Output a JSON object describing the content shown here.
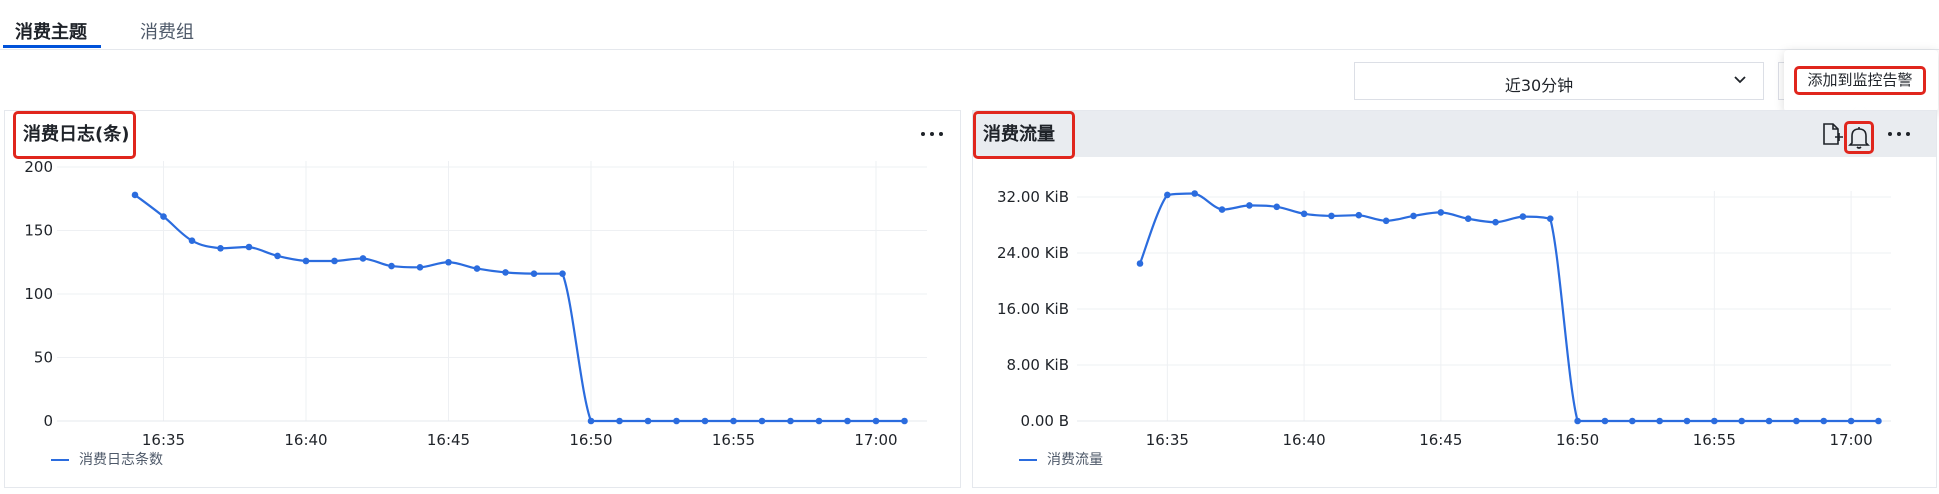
{
  "tabs": [
    {
      "label": "消费主题",
      "active": true
    },
    {
      "label": "消费组",
      "active": false
    }
  ],
  "time_range": {
    "selected": "近30分钟"
  },
  "tooltip": {
    "text": "添加到监控告警"
  },
  "icons": {
    "export": "add-file-icon",
    "alert": "bell-icon",
    "more": "more-dots-icon",
    "dropdown": "chevron-down-icon"
  },
  "colors": {
    "series": "#2b6cde",
    "highlight": "#e0261d",
    "active_tab": "#0052d9"
  },
  "panels": [
    {
      "title": "消费日志(条)",
      "legend": "消费日志条数"
    },
    {
      "title": "消费流量",
      "legend": "消费流量"
    }
  ],
  "chart_data": [
    {
      "type": "line",
      "title": "消费日志(条)",
      "xlabel": "",
      "ylabel": "",
      "x_ticks": [
        "16:35",
        "16:40",
        "16:45",
        "16:50",
        "16:55",
        "17:00"
      ],
      "y_ticks": [
        "200",
        "150",
        "100",
        "50",
        "0"
      ],
      "ylim": [
        0,
        200
      ],
      "grid": true,
      "legend_position": "bottom-left",
      "series": [
        {
          "name": "消费日志条数",
          "x": [
            "16:34",
            "16:35",
            "16:36",
            "16:37",
            "16:38",
            "16:39",
            "16:40",
            "16:41",
            "16:42",
            "16:43",
            "16:44",
            "16:45",
            "16:46",
            "16:47",
            "16:48",
            "16:49",
            "16:50",
            "16:51",
            "16:52",
            "16:53",
            "16:54",
            "16:55",
            "16:56",
            "16:57",
            "16:58",
            "16:59",
            "17:00",
            "17:01"
          ],
          "values": [
            178,
            161,
            142,
            136,
            137,
            130,
            126,
            126,
            128,
            122,
            121,
            125,
            120,
            117,
            116,
            116,
            0,
            0,
            0,
            0,
            0,
            0,
            0,
            0,
            0,
            0,
            0,
            0
          ]
        }
      ]
    },
    {
      "type": "line",
      "title": "消费流量",
      "xlabel": "",
      "ylabel": "",
      "unit": "KiB",
      "x_ticks": [
        "16:35",
        "16:40",
        "16:45",
        "16:50",
        "16:55",
        "17:00"
      ],
      "y_ticks": [
        "32.00 KiB",
        "24.00 KiB",
        "16.00 KiB",
        "8.00 KiB",
        "0.00 B"
      ],
      "ylim": [
        0,
        32
      ],
      "grid": true,
      "legend_position": "bottom-left",
      "series": [
        {
          "name": "消费流量",
          "x": [
            "16:34",
            "16:35",
            "16:36",
            "16:37",
            "16:38",
            "16:39",
            "16:40",
            "16:41",
            "16:42",
            "16:43",
            "16:44",
            "16:45",
            "16:46",
            "16:47",
            "16:48",
            "16:49",
            "16:50",
            "16:51",
            "16:52",
            "16:53",
            "16:54",
            "16:55",
            "16:56",
            "16:57",
            "16:58",
            "16:59",
            "17:00",
            "17:01"
          ],
          "values": [
            22.5,
            32.3,
            32.5,
            30.2,
            30.8,
            30.6,
            29.6,
            29.3,
            29.4,
            28.6,
            29.3,
            29.8,
            28.9,
            28.4,
            29.2,
            28.9,
            0,
            0,
            0,
            0,
            0,
            0,
            0,
            0,
            0,
            0,
            0,
            0
          ]
        }
      ]
    }
  ]
}
